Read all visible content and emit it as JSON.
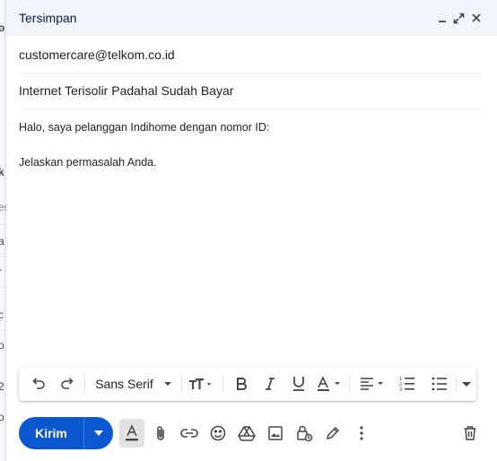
{
  "background_page": {
    "visible_fragments": [
      "o",
      "k",
      "es",
      "a",
      "r",
      "c",
      "o",
      "a",
      "2",
      "o"
    ]
  },
  "compose": {
    "title": "Tersimpan",
    "header_buttons": [
      {
        "name": "minimize",
        "icon": "minimize-icon"
      },
      {
        "name": "expand",
        "icon": "expand-icon"
      },
      {
        "name": "close",
        "icon": "close-icon"
      }
    ],
    "recipient": "customercare@telkom.co.id",
    "subject": "Internet Terisolir Padahal Sudah Bayar",
    "body": {
      "line1": "Halo, saya pelanggan Indihome dengan nomor ID:",
      "line2": "Jelaskan permasalah Anda."
    },
    "formatting": {
      "font": "Sans Serif",
      "tools": [
        "undo-icon",
        "redo-icon",
        "font-family-select",
        "text-size-icon",
        "bold-icon",
        "italic-icon",
        "underline-icon",
        "text-color-icon",
        "align-icon",
        "numbered-list-icon",
        "bulleted-list-icon",
        "more-formatting-icon"
      ]
    },
    "send": {
      "label": "Kirim"
    },
    "bottom_tools": [
      "formatting-options-icon",
      "attach-icon",
      "link-icon",
      "emoji-icon",
      "drive-icon",
      "photo-icon",
      "confidential-icon",
      "signature-icon",
      "more-options-icon",
      "discard-icon"
    ],
    "colors": {
      "header_bg": "#f2f6fc",
      "title": "#041e49",
      "send_bg": "#0b57d0",
      "icon": "#444746"
    }
  }
}
